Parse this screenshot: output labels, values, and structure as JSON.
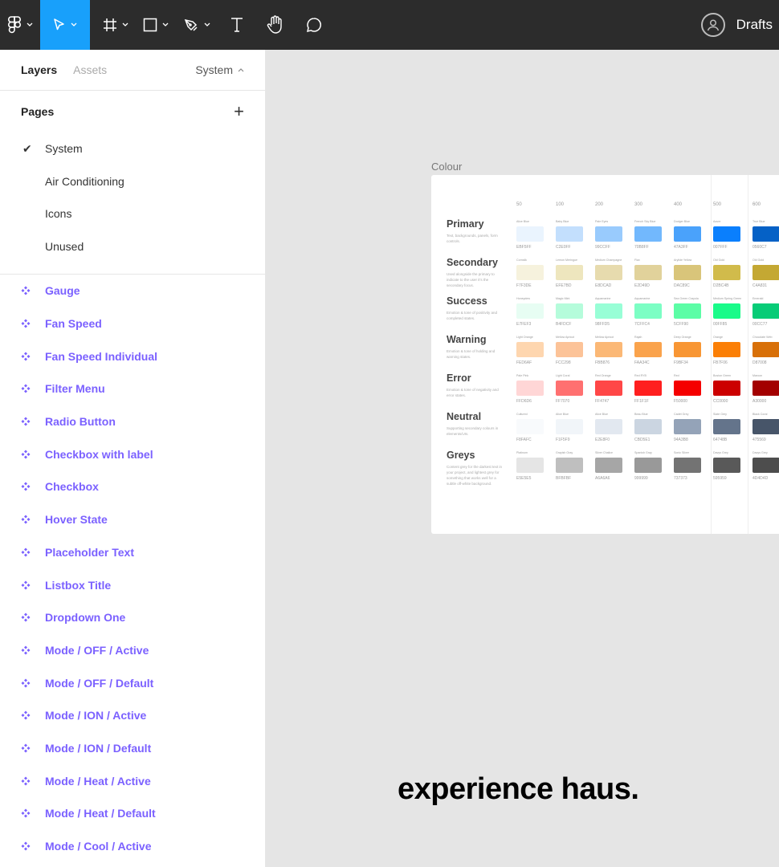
{
  "toolbar": {
    "tools": [
      "figma-menu",
      "move",
      "frame",
      "shape",
      "pen",
      "text",
      "hand",
      "comment"
    ],
    "drafts_label": "Drafts"
  },
  "sidebar": {
    "tab_layers": "Layers",
    "tab_assets": "Assets",
    "current_page": "System",
    "pages_title": "Pages",
    "add_page": "+",
    "pages": [
      {
        "label": "System",
        "selected": true
      },
      {
        "label": "Air Conditioning",
        "selected": false
      },
      {
        "label": "Icons",
        "selected": false
      },
      {
        "label": "Unused",
        "selected": false
      }
    ],
    "checkmark": "✔",
    "layers": [
      "Gauge",
      "Fan Speed",
      "Fan Speed Individual",
      "Filter Menu",
      "Radio Button",
      "Checkbox with label",
      "Checkbox",
      "Hover State",
      "Placeholder Text",
      "Listbox Title",
      "Dropdown One",
      "Mode / OFF / Active",
      "Mode / OFF / Default",
      "Mode / ION / Active",
      "Mode / ION / Default",
      "Mode / Heat / Active",
      "Mode / Heat / Default",
      "Mode / Cool / Active"
    ],
    "accent": "#7b61ff"
  },
  "canvas": {
    "frame_label": "Colour",
    "brand": "experience haus.",
    "scale": [
      "50",
      "100",
      "200",
      "300",
      "400",
      "500",
      "600"
    ],
    "rows": [
      {
        "title": "Primary",
        "desc": "Text, backgrounds, panels, form controls.",
        "names": [
          "Alice Blue",
          "Baby Blue",
          "Pale Eyes",
          "French Sky Blue",
          "Dodger Blue",
          "Azure",
          "True Blue"
        ],
        "hex": [
          "EBF5FF",
          "C2E0FF",
          "99CCFF",
          "70B8FF",
          "47A3FF",
          "007FFF",
          "0560C7"
        ]
      },
      {
        "title": "Secondary",
        "desc": "Used alongside the primary to indicate to the user it's the secondary focus.",
        "names": [
          "Cornsilk",
          "Lemon Meringue",
          "Medium Champagne",
          "Flax",
          "Arylide Yellow",
          "Old Gold",
          "Old Gold"
        ],
        "hex": [
          "F7F3DE",
          "EFE7BD",
          "E8DCAD",
          "E2D49D",
          "DAC89C",
          "D2BC4B",
          "C4A831"
        ]
      },
      {
        "title": "Success",
        "desc": "Emotion & tone of positivity and completed states.",
        "names": [
          "Honeydew",
          "Magic Mint",
          "Aquamarine",
          "Aquamarine",
          "Sea Green Crayola",
          "Medium Spring Green",
          "Emerald"
        ],
        "hex": [
          "E7FEF3",
          "B4FDCF",
          "98FFD5",
          "7CFFC4",
          "5CFF90",
          "00FF85",
          "00CC77"
        ]
      },
      {
        "title": "Warning",
        "desc": "Emotion & tone of holding and warning states.",
        "names": [
          "Light Orange",
          "Mellow Apricot",
          "Mellow Apricot",
          "Rajah",
          "Deep Orange",
          "Orange",
          "Chocolate Web"
        ],
        "hex": [
          "FED6AF",
          "FCC298",
          "FBB876",
          "FAA34C",
          "F9BF34",
          "FB7F06",
          "D87008"
        ]
      },
      {
        "title": "Error",
        "desc": "Emotion & tone of negativity and error states.",
        "names": [
          "Pale Pink",
          "Light Coral",
          "Red Orange",
          "Red RYB",
          "Red",
          "Boston Green",
          "Maroon"
        ],
        "hex": [
          "FFD6D6",
          "FF7070",
          "FF4747",
          "FF1F1F",
          "F50000",
          "CC0000",
          "A30000"
        ]
      },
      {
        "title": "Neutral",
        "desc": "Supporting secondary colours in elements/UIs.",
        "names": [
          "Cultured",
          "Alice Blue",
          "Alice Blue",
          "Beau Blue",
          "Cadet Grey",
          "Slate Grey",
          "Black Coral"
        ],
        "hex": [
          "F8FAFC",
          "F1F5F9",
          "E2E8F0",
          "CBD5E1",
          "94A3B8",
          "64748B",
          "475569"
        ]
      },
      {
        "title": "Greys",
        "desc": "Content grey for the darkest text in your project, and lightest grey for something that works well for a subtle off-white background.",
        "names": [
          "Platinum",
          "Grayish Gray",
          "Silver Chalice",
          "Spanish Gray",
          "Sonic Silver",
          "Davys Grey",
          "Davys Grey"
        ],
        "hex": [
          "E5E5E5",
          "BFBFBF",
          "A6A6A6",
          "999999",
          "737373",
          "595959",
          "4D4D4D"
        ]
      }
    ],
    "swatch_colors": [
      [
        "#eaf4fe",
        "#c3dffd",
        "#99cbfd",
        "#72b8fd",
        "#4aa2fb",
        "#0a7ffd",
        "#0561c6"
      ],
      [
        "#f6f2dd",
        "#eee6be",
        "#e7dbae",
        "#e1d29b",
        "#d9c57a",
        "#d1bb4b",
        "#c4a833"
      ],
      [
        "#e7fdf3",
        "#b5fcdb",
        "#98fed6",
        "#7cfec4",
        "#5cfda6",
        "#19fb89",
        "#07cc77"
      ],
      [
        "#fed6af",
        "#fcc398",
        "#fbb876",
        "#faa34c",
        "#f89634",
        "#fb7f06",
        "#d87008"
      ],
      [
        "#ffd6d6",
        "#ff7070",
        "#ff4747",
        "#ff1f1f",
        "#f50000",
        "#cc0000",
        "#a30000"
      ],
      [
        "#f8fafc",
        "#f1f5f9",
        "#e2e8f0",
        "#cbd5e1",
        "#94a3b8",
        "#64748b",
        "#475569"
      ],
      [
        "#e5e5e5",
        "#bfbfbf",
        "#a6a6a6",
        "#999999",
        "#737373",
        "#595959",
        "#4d4d4d"
      ]
    ]
  }
}
